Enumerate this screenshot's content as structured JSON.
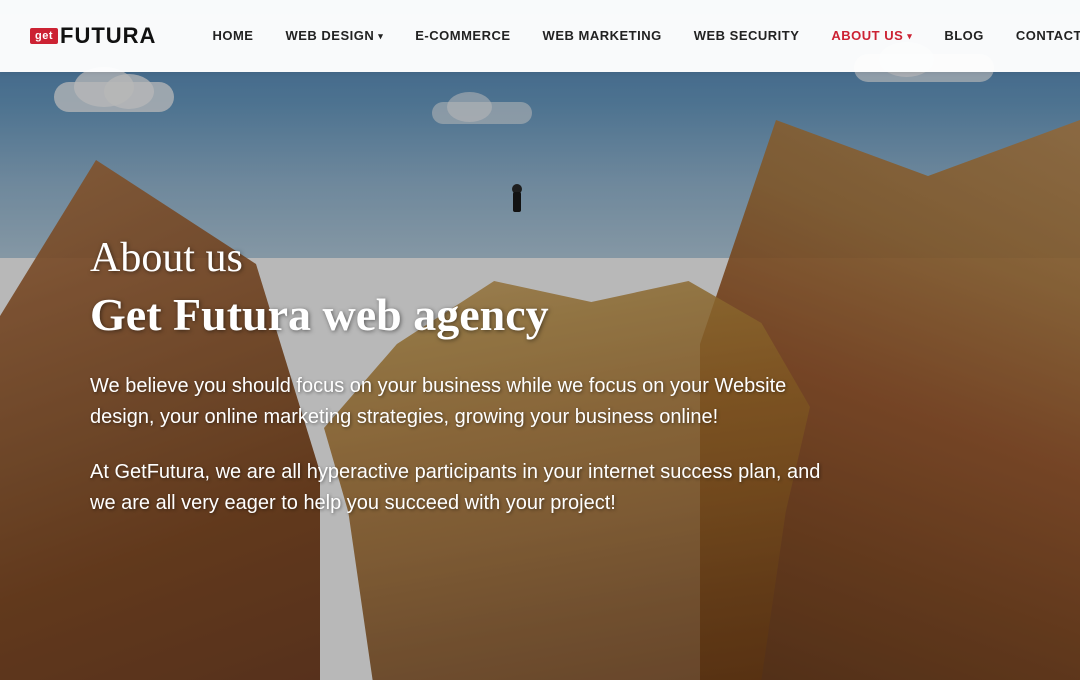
{
  "logo": {
    "get": "get",
    "futura": "FUTURA"
  },
  "nav": {
    "items": [
      {
        "label": "HOME",
        "hasDropdown": false,
        "active": false
      },
      {
        "label": "WEB DESIGN",
        "hasDropdown": true,
        "active": false
      },
      {
        "label": "E-COMMERCE",
        "hasDropdown": false,
        "active": false
      },
      {
        "label": "WEB MARKETING",
        "hasDropdown": false,
        "active": false
      },
      {
        "label": "WEB SECURITY",
        "hasDropdown": false,
        "active": false
      },
      {
        "label": "ABOUT US",
        "hasDropdown": true,
        "active": true
      },
      {
        "label": "BLOG",
        "hasDropdown": false,
        "active": false
      },
      {
        "label": "CONTACT US",
        "hasDropdown": false,
        "active": false
      }
    ]
  },
  "hero": {
    "about_label": "About us",
    "title": "Get Futura web agency",
    "desc1": "We believe you should focus on your business while we focus on your Website design, your online marketing strategies, growing your business online!",
    "desc2": "At GetFutura, we are all hyperactive participants in your internet success plan, and we are all very eager to help you succeed with your project!",
    "colors": {
      "accent": "#cc2233"
    }
  }
}
